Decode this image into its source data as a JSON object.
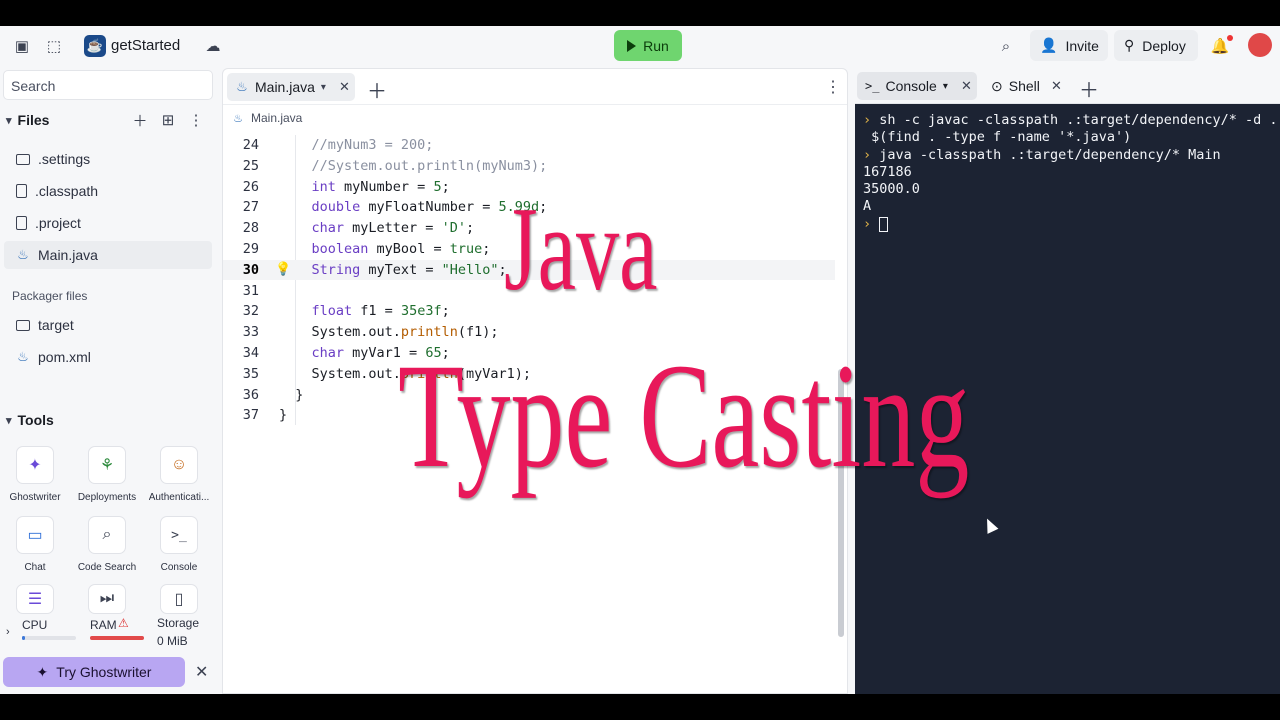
{
  "header": {
    "repl_name": "getStarted",
    "run_label": "Run",
    "invite_label": "Invite",
    "deploy_label": "Deploy"
  },
  "sidebar": {
    "search_placeholder": "Search",
    "files_title": "Files",
    "files": [
      ".settings",
      ".classpath",
      ".project",
      "Main.java"
    ],
    "packager_title": "Packager files",
    "packager_files": [
      "target",
      "pom.xml"
    ],
    "tools_title": "Tools",
    "tools": [
      "Ghostwriter",
      "Deployments",
      "Authenticati...",
      "Chat",
      "Code Search",
      "Console"
    ],
    "resources": {
      "cpu_label": "CPU",
      "ram_label": "RAM",
      "storage_label": "Storage",
      "storage_value": "0 MiB",
      "cpu_usage": 0.05,
      "ram_usage": 1.0
    },
    "try_ghostwriter": "Try Ghostwriter"
  },
  "editor": {
    "tab_label": "Main.java",
    "breadcrumb": "Main.java",
    "current_line": 30,
    "lines": [
      {
        "n": "24",
        "text": "    //myNum3 = 200;"
      },
      {
        "n": "25",
        "text": "    //System.out.println(myNum3);"
      },
      {
        "n": "26",
        "text": "    int myNumber = 5;"
      },
      {
        "n": "27",
        "text": "    double myFloatNumber = 5.99d;"
      },
      {
        "n": "28",
        "text": "    char myLetter = 'D';"
      },
      {
        "n": "29",
        "text": "    boolean myBool = true;"
      },
      {
        "n": "30",
        "text": "    String myText = \"Hello\";"
      },
      {
        "n": "31",
        "text": ""
      },
      {
        "n": "32",
        "text": "    float f1 = 35e3f;"
      },
      {
        "n": "33",
        "text": "    System.out.println(f1);"
      },
      {
        "n": "34",
        "text": "    char myVar1 = 65;"
      },
      {
        "n": "35",
        "text": "    System.out.println(myVar1);"
      },
      {
        "n": "36",
        "text": "  }"
      },
      {
        "n": "37",
        "text": "}"
      }
    ]
  },
  "console": {
    "tab_console": "Console",
    "tab_shell": "Shell",
    "lines": [
      "sh -c javac -classpath .:target/dependency/* -d .",
      " $(find . -type f -name '*.java')",
      "java -classpath .:target/dependency/* Main",
      "167186",
      "35000.0",
      "A"
    ]
  },
  "overlay": {
    "line1": "Java",
    "line2": "Type Casting"
  },
  "colors": {
    "run_green": "#6fd56f",
    "overlay_pink": "#e8185a",
    "terminal_bg": "#1c2333"
  }
}
